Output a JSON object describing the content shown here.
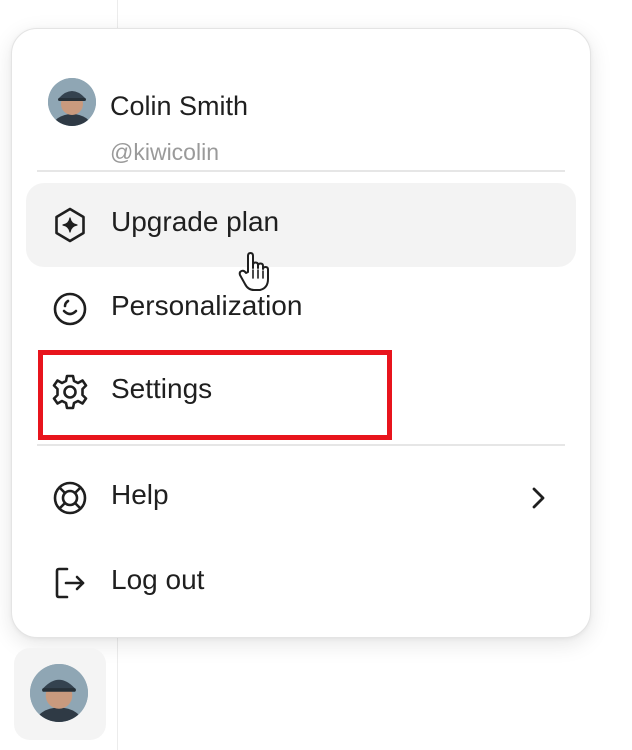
{
  "profile": {
    "name": "Colin Smith",
    "handle": "@kiwicolin"
  },
  "menu": {
    "items": [
      {
        "label": "Upgrade plan",
        "icon": "upgrade-sparkle-hexagon-icon"
      },
      {
        "label": "Personalization",
        "icon": "personalization-smiley-icon"
      },
      {
        "label": "Settings",
        "icon": "gear-icon"
      },
      {
        "label": "Help",
        "icon": "lifebuoy-icon",
        "has_submenu": true
      },
      {
        "label": "Log out",
        "icon": "logout-icon"
      }
    ],
    "hovered_item": "Upgrade plan"
  },
  "annotation": {
    "highlight_color": "#e8141c",
    "highlighted_item": "Settings"
  },
  "colors": {
    "text": "#1f1f1f",
    "muted": "#9a9a9a",
    "hover_bg": "#f3f3f3"
  }
}
